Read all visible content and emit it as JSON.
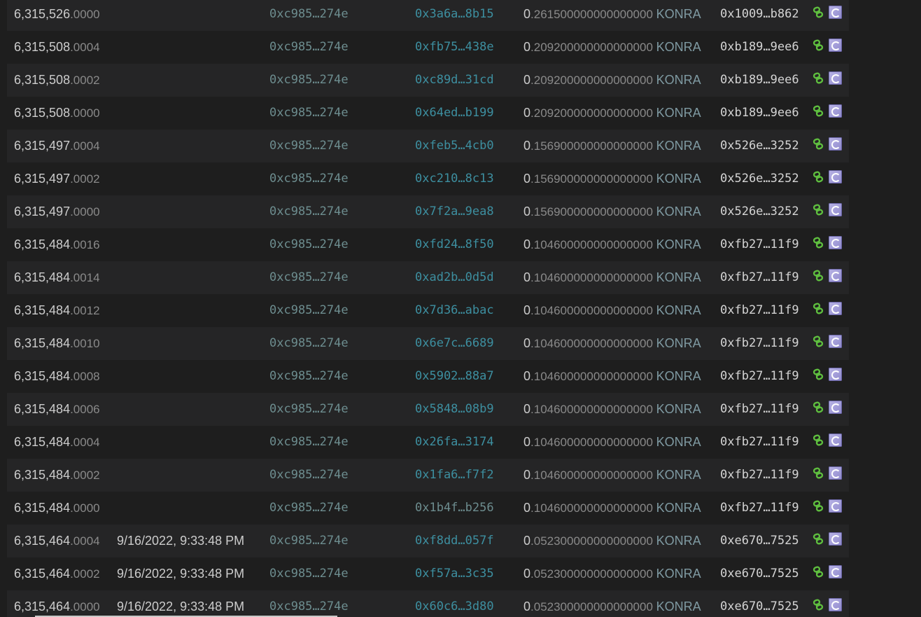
{
  "token": "KONRA",
  "rows": [
    {
      "id_int": "6,315,526",
      "id_frac": ".0000",
      "time": "",
      "from": "0xc985…274e",
      "hash": "0x3a6a…8b15",
      "hash_link": true,
      "val_lead": "0",
      "val_rest": ".261500000000000000",
      "token": "KONRA",
      "to": "0x1009…b862"
    },
    {
      "id_int": "6,315,508",
      "id_frac": ".0004",
      "time": "",
      "from": "0xc985…274e",
      "hash": "0xfb75…438e",
      "hash_link": true,
      "val_lead": "0",
      "val_rest": ".209200000000000000",
      "token": "KONRA",
      "to": "0xb189…9ee6"
    },
    {
      "id_int": "6,315,508",
      "id_frac": ".0002",
      "time": "",
      "from": "0xc985…274e",
      "hash": "0xc89d…31cd",
      "hash_link": true,
      "val_lead": "0",
      "val_rest": ".209200000000000000",
      "token": "KONRA",
      "to": "0xb189…9ee6"
    },
    {
      "id_int": "6,315,508",
      "id_frac": ".0000",
      "time": "",
      "from": "0xc985…274e",
      "hash": "0x64ed…b199",
      "hash_link": true,
      "val_lead": "0",
      "val_rest": ".209200000000000000",
      "token": "KONRA",
      "to": "0xb189…9ee6"
    },
    {
      "id_int": "6,315,497",
      "id_frac": ".0004",
      "time": "",
      "from": "0xc985…274e",
      "hash": "0xfeb5…4cb0",
      "hash_link": true,
      "val_lead": "0",
      "val_rest": ".156900000000000000",
      "token": "KONRA",
      "to": "0x526e…3252"
    },
    {
      "id_int": "6,315,497",
      "id_frac": ".0002",
      "time": "",
      "from": "0xc985…274e",
      "hash": "0xc210…8c13",
      "hash_link": true,
      "val_lead": "0",
      "val_rest": ".156900000000000000",
      "token": "KONRA",
      "to": "0x526e…3252"
    },
    {
      "id_int": "6,315,497",
      "id_frac": ".0000",
      "time": "",
      "from": "0xc985…274e",
      "hash": "0x7f2a…9ea8",
      "hash_link": true,
      "val_lead": "0",
      "val_rest": ".156900000000000000",
      "token": "KONRA",
      "to": "0x526e…3252"
    },
    {
      "id_int": "6,315,484",
      "id_frac": ".0016",
      "time": "",
      "from": "0xc985…274e",
      "hash": "0xfd24…8f50",
      "hash_link": true,
      "val_lead": "0",
      "val_rest": ".104600000000000000",
      "token": "KONRA",
      "to": "0xfb27…11f9"
    },
    {
      "id_int": "6,315,484",
      "id_frac": ".0014",
      "time": "",
      "from": "0xc985…274e",
      "hash": "0xad2b…0d5d",
      "hash_link": true,
      "val_lead": "0",
      "val_rest": ".104600000000000000",
      "token": "KONRA",
      "to": "0xfb27…11f9"
    },
    {
      "id_int": "6,315,484",
      "id_frac": ".0012",
      "time": "",
      "from": "0xc985…274e",
      "hash": "0x7d36…abac",
      "hash_link": true,
      "val_lead": "0",
      "val_rest": ".104600000000000000",
      "token": "KONRA",
      "to": "0xfb27…11f9"
    },
    {
      "id_int": "6,315,484",
      "id_frac": ".0010",
      "time": "",
      "from": "0xc985…274e",
      "hash": "0x6e7c…6689",
      "hash_link": true,
      "val_lead": "0",
      "val_rest": ".104600000000000000",
      "token": "KONRA",
      "to": "0xfb27…11f9"
    },
    {
      "id_int": "6,315,484",
      "id_frac": ".0008",
      "time": "",
      "from": "0xc985…274e",
      "hash": "0x5902…88a7",
      "hash_link": true,
      "val_lead": "0",
      "val_rest": ".104600000000000000",
      "token": "KONRA",
      "to": "0xfb27…11f9"
    },
    {
      "id_int": "6,315,484",
      "id_frac": ".0006",
      "time": "",
      "from": "0xc985…274e",
      "hash": "0x5848…08b9",
      "hash_link": true,
      "val_lead": "0",
      "val_rest": ".104600000000000000",
      "token": "KONRA",
      "to": "0xfb27…11f9"
    },
    {
      "id_int": "6,315,484",
      "id_frac": ".0004",
      "time": "",
      "from": "0xc985…274e",
      "hash": "0x26fa…3174",
      "hash_link": true,
      "val_lead": "0",
      "val_rest": ".104600000000000000",
      "token": "KONRA",
      "to": "0xfb27…11f9"
    },
    {
      "id_int": "6,315,484",
      "id_frac": ".0002",
      "time": "",
      "from": "0xc985…274e",
      "hash": "0x1fa6…f7f2",
      "hash_link": true,
      "val_lead": "0",
      "val_rest": ".104600000000000000",
      "token": "KONRA",
      "to": "0xfb27…11f9"
    },
    {
      "id_int": "6,315,484",
      "id_frac": ".0000",
      "time": "",
      "from": "0xc985…274e",
      "hash": "0x1b4f…b256",
      "hash_link": false,
      "val_lead": "0",
      "val_rest": ".104600000000000000",
      "token": "KONRA",
      "to": "0xfb27…11f9"
    },
    {
      "id_int": "6,315,464",
      "id_frac": ".0004",
      "time": "9/16/2022, 9:33:48 PM",
      "from": "0xc985…274e",
      "hash": "0xf8dd…057f",
      "hash_link": true,
      "val_lead": "0",
      "val_rest": ".052300000000000000",
      "token": "KONRA",
      "to": "0xe670…7525"
    },
    {
      "id_int": "6,315,464",
      "id_frac": ".0002",
      "time": "9/16/2022, 9:33:48 PM",
      "from": "0xc985…274e",
      "hash": "0xf57a…3c35",
      "hash_link": true,
      "val_lead": "0",
      "val_rest": ".052300000000000000",
      "token": "KONRA",
      "to": "0xe670…7525"
    },
    {
      "id_int": "6,315,464",
      "id_frac": ".0000",
      "time": "9/16/2022, 9:33:48 PM",
      "from": "0xc985…274e",
      "hash": "0x60c6…3d80",
      "hash_link": true,
      "val_lead": "0",
      "val_rest": ".052300000000000000",
      "token": "KONRA",
      "to": "0xe670…7525"
    }
  ],
  "icons": {
    "link": "link-icon",
    "image": "token-logo-icon"
  },
  "colors": {
    "background": "#1e1e1e",
    "row_alt": "#252526",
    "link": "#3d8fa0",
    "link_icon": "#5fbf3f"
  }
}
